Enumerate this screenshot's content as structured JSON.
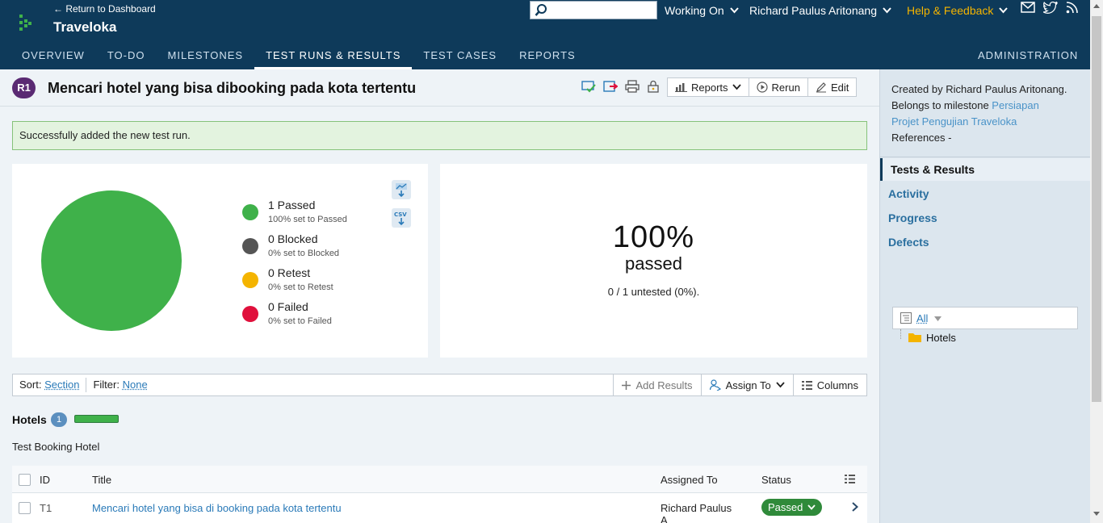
{
  "header": {
    "back_link": "← Return to Dashboard",
    "project_name": "Traveloka",
    "search_placeholder": "",
    "working_on": "Working On",
    "user_name": "Richard Paulus Aritonang",
    "help": "Help & Feedback",
    "nav": [
      "OVERVIEW",
      "TO-DO",
      "MILESTONES",
      "TEST RUNS & RESULTS",
      "TEST CASES",
      "REPORTS"
    ],
    "active_nav": "TEST RUNS & RESULTS",
    "admin": "ADMINISTRATION",
    "icons": [
      "mail-icon",
      "twitter-icon",
      "rss-icon"
    ]
  },
  "run": {
    "badge": "R1",
    "title": "Mencari hotel yang bisa dibooking pada kota tertentu",
    "buttons": {
      "reports": "Reports",
      "rerun": "Rerun",
      "edit": "Edit"
    }
  },
  "message": "Successfully added the new test run.",
  "chart_data": {
    "type": "pie",
    "title": "",
    "categories": [
      "Passed",
      "Blocked",
      "Retest",
      "Failed"
    ],
    "values": [
      1,
      0,
      0,
      0
    ],
    "colors": [
      "#3fb14a",
      "#555555",
      "#f4b400",
      "#e0103c"
    ],
    "legend": [
      {
        "label": "1 Passed",
        "sub": "100% set to Passed"
      },
      {
        "label": "0 Blocked",
        "sub": "0% set to Blocked"
      },
      {
        "label": "0 Retest",
        "sub": "0% set to Retest"
      },
      {
        "label": "0 Failed",
        "sub": "0% set to Failed"
      }
    ],
    "legend_placement": "right",
    "export_icons": [
      "chart-export-icon",
      "csv-export-icon"
    ],
    "csv_label": "CSV"
  },
  "summary": {
    "percent": "100%",
    "label": "passed",
    "sub": "0 / 1 untested (0%)."
  },
  "toolbar": {
    "sort_label": "Sort:",
    "sort_value": "Section",
    "filter_label": "Filter:",
    "filter_value": "None",
    "add_results": "Add Results",
    "assign_to": "Assign To",
    "columns": "Columns"
  },
  "section": {
    "title": "Hotels",
    "count": "1",
    "description": "Test Booking Hotel",
    "progress": 1.0
  },
  "table": {
    "headers": {
      "id": "ID",
      "title": "Title",
      "assigned": "Assigned To",
      "status": "Status"
    },
    "rows": [
      {
        "id": "T1",
        "title": "Mencari hotel yang bisa di booking pada kota tertentu",
        "assigned": "Richard Paulus",
        "assigned_line2": "A",
        "status": "Passed"
      }
    ]
  },
  "sidebar": {
    "created_by": "Created by Richard Paulus Aritonang.",
    "belongs_prefix": "Belongs to milestone ",
    "milestone_line1": "Persiapan",
    "milestone_line2": "Projet Pengujian Traveloka",
    "references": "References -",
    "nav": [
      "Tests & Results",
      "Activity",
      "Progress",
      "Defects"
    ],
    "filter_all": "All",
    "tree_item": "Hotels"
  }
}
